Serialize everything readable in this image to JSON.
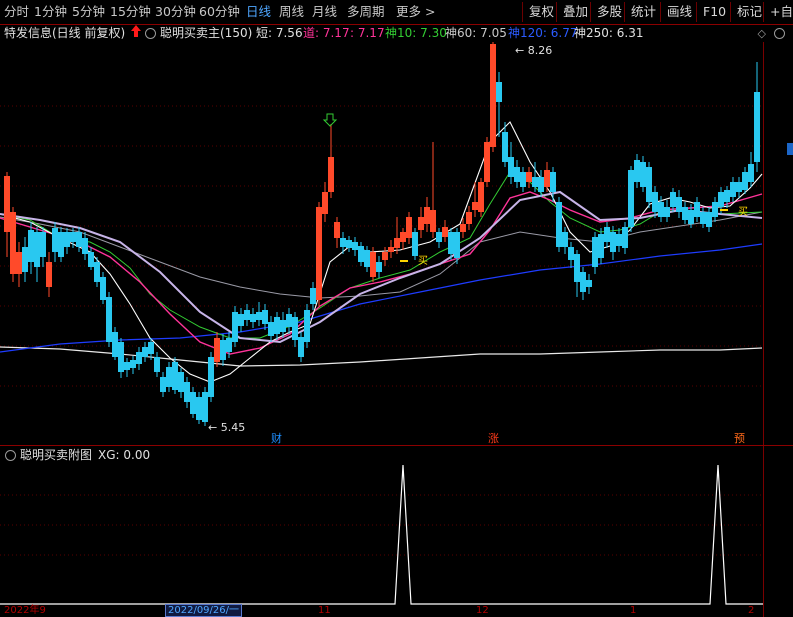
{
  "toolbar": {
    "periods": [
      "分时",
      "1分钟",
      "5分钟",
      "15分钟",
      "30分钟",
      "60分钟",
      "日线",
      "周线",
      "月线",
      "多周期",
      "更多 >"
    ],
    "active_period": "日线",
    "right_buttons": [
      "复权",
      "叠加",
      "多股",
      "统计",
      "画线",
      "F10",
      "标记",
      "+自选"
    ]
  },
  "info_bar": {
    "stock_name": "特发信息(日线 前复权)",
    "indicator": "聪明买卖主(150)",
    "short_label": "短: 7.56",
    "dao_label": "道: 7.17",
    "dao2_label": ": 7.17",
    "shen10": "神10: 7.30",
    "shen60": "神60: 7.05",
    "shen120": "神120: 6.77",
    "shen250": "神250: 6.31"
  },
  "main_chart": {
    "high_label": "8.26",
    "low_label": "5.45",
    "markers": [
      "财",
      "涨",
      "预"
    ],
    "buy_label": "买",
    "colors": {
      "up": "#ff4a2a",
      "down": "#29c8f0",
      "short": "#ffffff",
      "dao": "#ff3399",
      "shen10": "#33cc33",
      "shen60": "#b0a0d0",
      "shen120": "#1e3cff",
      "shen250": "#e8e8e8"
    }
  },
  "sub_chart": {
    "title": "聪明买卖附图",
    "xg_label": "XG: 0.00"
  },
  "date_axis": {
    "labels": [
      "2022年9",
      "2022/09/26/一",
      "11",
      "12",
      "1",
      "2"
    ]
  }
}
